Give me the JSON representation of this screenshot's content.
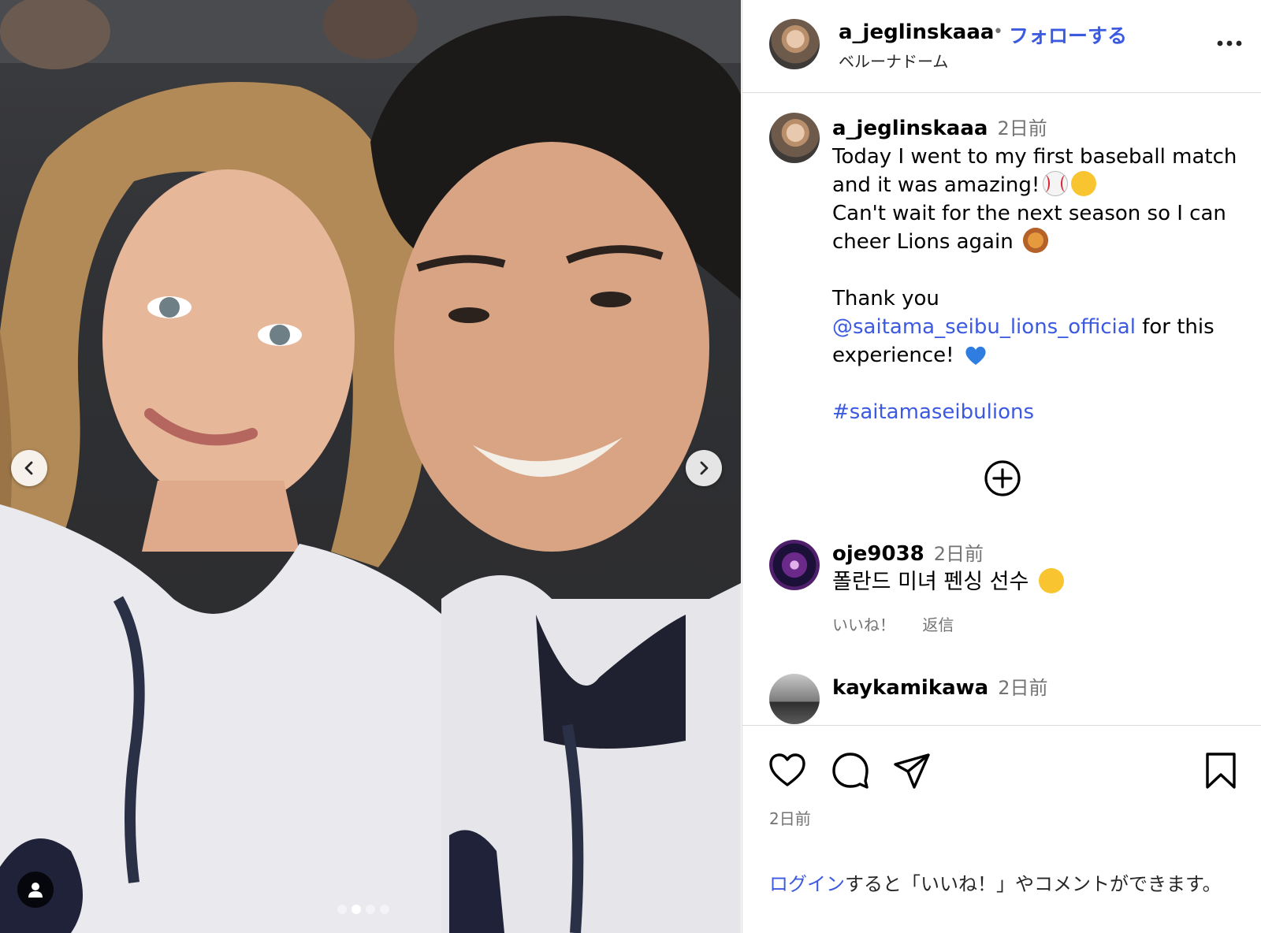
{
  "header": {
    "username": "a_jeglinskaaa",
    "separator": "•",
    "follow_label": "フォローする",
    "location": "ベルーナドーム"
  },
  "caption": {
    "username": "a_jeglinskaaa",
    "time": "2日前",
    "line1": "Today I went to my first baseball match",
    "line2": "and it was amazing!",
    "line3": "Can't wait for the next season so I can",
    "line4": "cheer Lions again",
    "line5": "Thank you",
    "mention": "@saitama_seibu_lions_official",
    "line6_rest": "for this",
    "line7": "experience!",
    "hashtag": "#saitamaseibulions"
  },
  "comments": [
    {
      "username": "oje9038",
      "time": "2日前",
      "text": "폴란드 미녀 펜싱 선수",
      "like_label": "いいね！",
      "reply_label": "返信"
    },
    {
      "username": "kaykamikawa",
      "time": "2日前",
      "text": ""
    }
  ],
  "post": {
    "date": "2日前",
    "login_link": "ログイン",
    "login_rest": "すると「いいね！」やコメントができます。"
  },
  "carousel": {
    "total": 4,
    "active_index": 1
  },
  "colors": {
    "accent": "#3c5ae0",
    "secondary_text": "#737373",
    "divider": "#dbdbdb"
  },
  "icons": [
    "chevron-left-icon",
    "chevron-right-icon",
    "user-tag-icon",
    "more-icon",
    "plus-circle-icon",
    "heart-icon",
    "comment-icon",
    "share-icon",
    "bookmark-icon"
  ]
}
